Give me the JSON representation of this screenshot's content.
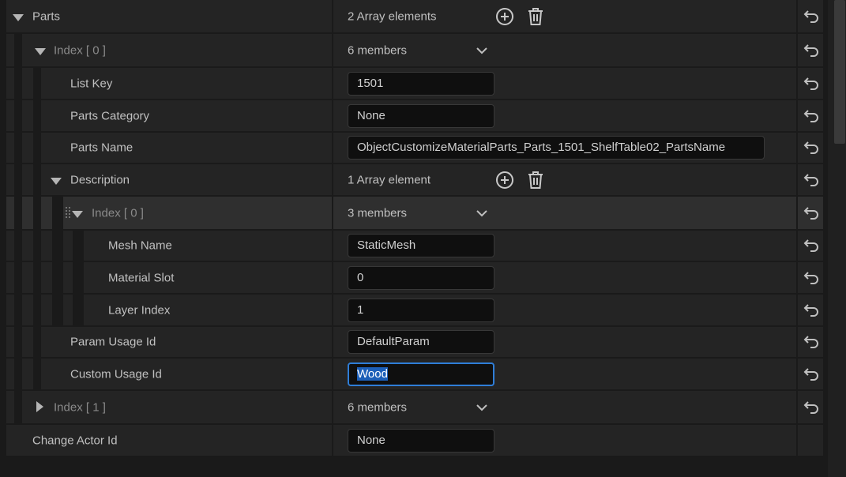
{
  "rows": {
    "parts": {
      "label": "Parts",
      "value": "2 Array elements"
    },
    "index0": {
      "label": "Index [ 0 ]",
      "value": "6 members"
    },
    "list_key": {
      "label": "List Key",
      "value": "1501"
    },
    "parts_category": {
      "label": "Parts Category",
      "value": "None"
    },
    "parts_name": {
      "label": "Parts Name",
      "value": "ObjectCustomizeMaterialParts_Parts_1501_ShelfTable02_PartsName"
    },
    "description": {
      "label": "Description",
      "value": "1 Array element"
    },
    "desc_index0": {
      "label": "Index [ 0 ]",
      "value": "3 members"
    },
    "mesh_name": {
      "label": "Mesh Name",
      "value": "StaticMesh"
    },
    "material_slot": {
      "label": "Material Slot",
      "value": "0"
    },
    "layer_index": {
      "label": "Layer Index",
      "value": "1"
    },
    "param_usage_id": {
      "label": "Param Usage Id",
      "value": "DefaultParam"
    },
    "custom_usage_id": {
      "label": "Custom Usage Id",
      "value": "Wood"
    },
    "index1": {
      "label": "Index [ 1 ]",
      "value": "6 members"
    },
    "change_actor_id": {
      "label": "Change Actor Id",
      "value": "None"
    }
  },
  "colors": {
    "background": "#1a1a1a",
    "row": "#242424",
    "row_highlight": "#2f2f2f",
    "focus_border": "#2f7ed8",
    "selection": "#1c5fb8"
  },
  "icons": [
    "expand-arrow-icon",
    "collapse-arrow-icon",
    "add-element-icon",
    "delete-all-icon",
    "dropdown-chevron-icon",
    "reset-to-default-icon",
    "drag-grip-icon"
  ]
}
